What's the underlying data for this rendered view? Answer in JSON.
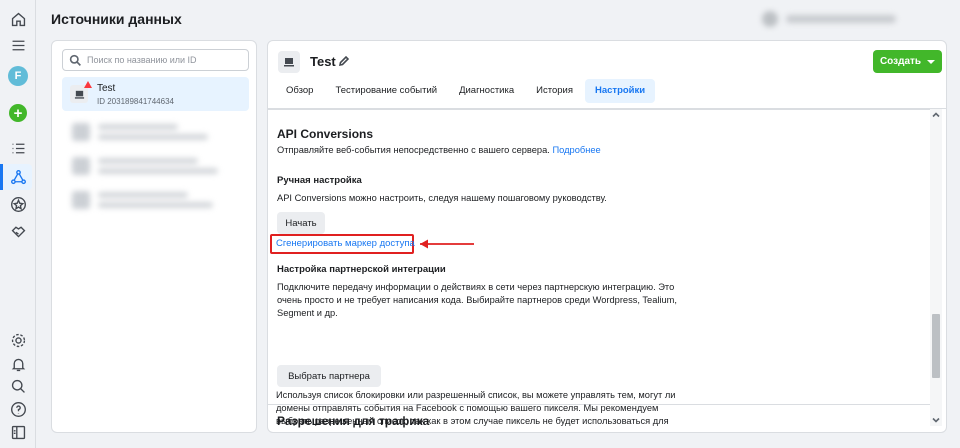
{
  "header": {
    "title": "Источники данных"
  },
  "rail": {
    "avatar_letter": "F",
    "plus": "+"
  },
  "sources": {
    "search_placeholder": "Поиск по названию или ID",
    "selected": {
      "name": "Test",
      "id_line": "ID 203189841744634"
    }
  },
  "detail": {
    "title": "Test",
    "create_button": "Создать",
    "tabs": [
      {
        "label": "Обзор"
      },
      {
        "label": "Тестирование событий"
      },
      {
        "label": "Диагностика"
      },
      {
        "label": "История"
      },
      {
        "label": "Настройки",
        "active": true
      }
    ],
    "api": {
      "heading": "API Conversions",
      "desc": "Отправляйте веб-события непосредственно с вашего сервера.",
      "more_link": "Подробнее",
      "manual_heading": "Ручная настройка",
      "manual_desc": "API Conversions можно настроить, следуя нашему пошаговому руководству.",
      "start_button": "Начать",
      "generate_link": "Сгенерировать маркер доступа",
      "partner_heading": "Настройка партнерской интеграции",
      "partner_desc_1": "Подключите передачу информации о действиях в сети через партнерскую интеграцию. Это",
      "partner_desc_2": "очень просто и не требует написания кода. Выбирайте партнеров среди Wordpress, Tealium,",
      "partner_desc_3": "Segment и др.",
      "partner_button": "Выбрать партнера"
    },
    "traffic": {
      "heading": "Разрешения для трафика",
      "desc_1": "Используя список блокировки или разрешенный список, вы можете управлять тем, могут ли",
      "desc_2": "домены отправлять события на Facebook с помощью вашего пикселя. Мы рекомендуем",
      "desc_3": "выбрать разрешенный список, так как в этом случае пиксель не будет использоваться для"
    }
  },
  "colors": {
    "accent": "#1877f2",
    "create_green": "#42b72a",
    "highlight_red": "#e02020"
  }
}
